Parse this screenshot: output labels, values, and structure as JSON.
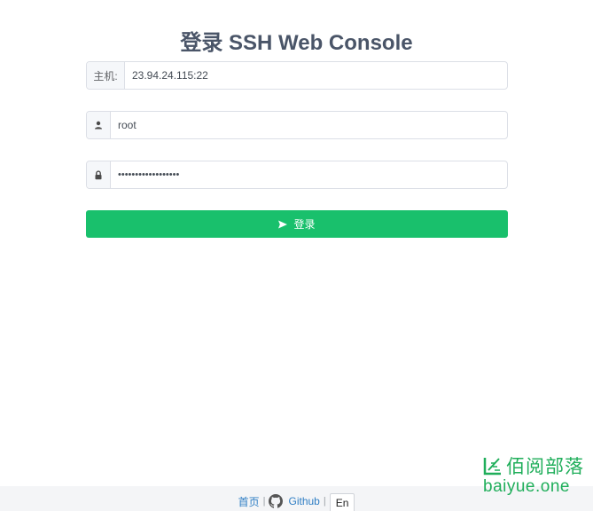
{
  "title": "登录 SSH Web Console",
  "form": {
    "host_label": "主机:",
    "host_value": "23.94.24.115:22",
    "user_icon": "user-icon",
    "user_value": "root",
    "password_icon": "lock-icon",
    "password_value": "••••••••••••••••••",
    "login_label": "登录",
    "login_icon": "send-icon"
  },
  "footer": {
    "home_label": "首页",
    "sep": "|",
    "github_icon": "github-icon",
    "github_label": "Github",
    "lang_label": "En"
  },
  "watermark": {
    "brand": "佰阅部落",
    "domain": "baiyue.one"
  },
  "colors": {
    "primary": "#19c06c",
    "title": "#4a5568",
    "link": "#2f7ec4",
    "watermark": "#1fae5a"
  }
}
